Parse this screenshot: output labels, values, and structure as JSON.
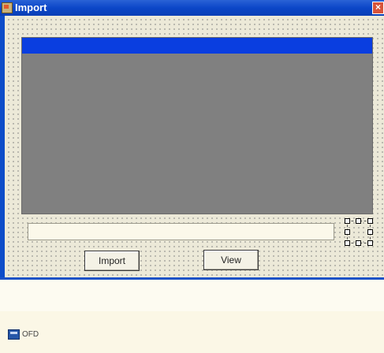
{
  "window": {
    "title": "Import",
    "close_glyph": "×"
  },
  "form": {
    "grid_view": {
      "has_header": true,
      "header_color": "#0a3ee0",
      "body_color": "#808080"
    },
    "path_input": {
      "value": ""
    },
    "buttons": {
      "import_label": "Import",
      "view_label": "View"
    }
  },
  "component_tray": {
    "items": [
      {
        "label": "OFD",
        "icon": "open-file-dialog-icon"
      }
    ]
  },
  "colors": {
    "titlebar": "#0b46c8",
    "form_surface": "#ece9d8",
    "close_button": "#d8533a"
  }
}
